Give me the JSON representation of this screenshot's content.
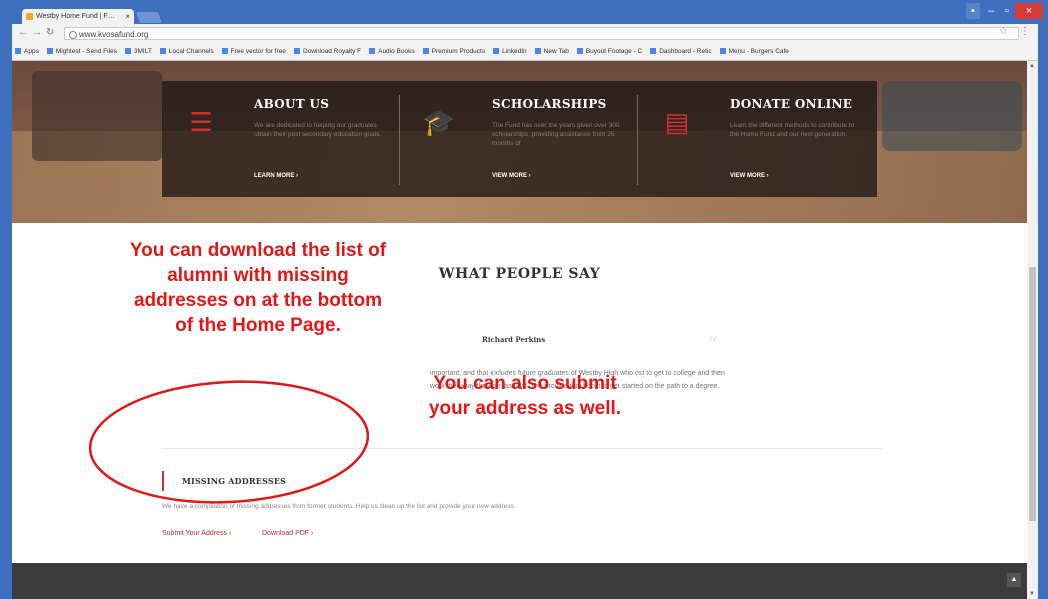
{
  "browser": {
    "tab_title": "Westby Home Fund | F…",
    "url": "www.kvosafund.org",
    "bookmarks": [
      "Apps",
      "Mightest - Send Files",
      "3MILT",
      "Local Channels",
      "Free vector for free",
      "Download Royalty F",
      "Audio Books",
      "Premium Products",
      "LinkedIn",
      "New Tab",
      "Buyout Footage - C",
      "Dashboard - Retic",
      "Menu - Burgers Cafe"
    ]
  },
  "features": [
    {
      "title": "ABOUT US",
      "text": "We are dedicated to helping our graduates obtain their post secondary education goals.",
      "link": "LEARN MORE ›"
    },
    {
      "title": "SCHOLARSHIPS",
      "text": "The Fund has over the years given over 300 scholarships, providing assistance from 25 months of",
      "link": "VIEW MORE ›"
    },
    {
      "title": "DONATE ONLINE",
      "text": "Learn the different methods to contribute to the Home Fund and our next generation.",
      "link": "VIEW MORE ›"
    }
  ],
  "testimonials": {
    "heading": "WHAT PEOPLE SAY",
    "author": "Richard Perkins",
    "quote": "important, and that includes future graduates of Westby High who ost to get to college and then work their way through, as I did. The provide that boost to get started on the path to a degree."
  },
  "missing": {
    "title": "MISSING ADDRESSES",
    "text": "We have a compilation of missing addresses from former students.  Help us clean up the list and provide your new address.",
    "submit_link": "Submit Your Address ›",
    "download_link": "Download PDF ›"
  },
  "annotations": {
    "left": [
      "You can download the list of",
      "alumni with missing",
      "addresses on at the bottom",
      "of the Home Page."
    ],
    "right": [
      "You can also submit",
      "your address as well."
    ]
  },
  "colors": {
    "accent": "#d32f2f",
    "annotation": "#e01818",
    "footer": "#3b3b3b"
  }
}
